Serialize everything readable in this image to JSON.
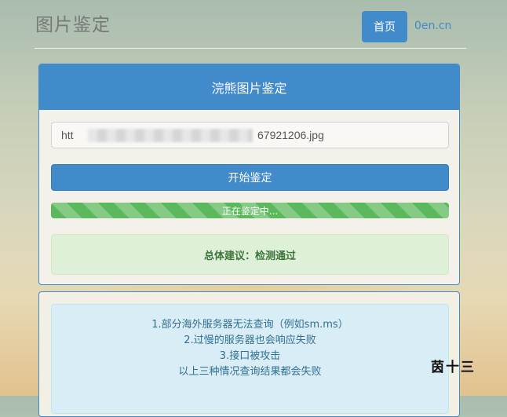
{
  "header": {
    "brand": "图片鉴定",
    "nav": {
      "home_label": "首页",
      "link_label": "0en.cn"
    }
  },
  "panel": {
    "title": "浣熊图片鉴定",
    "url_value_prefix": "htt",
    "url_value_suffix": "67921206.jpg",
    "start_button": "开始鉴定",
    "progress": {
      "label": "正在鉴定中...",
      "percent": 100
    },
    "result": "总体建议：检测通过"
  },
  "notice": {
    "lines": [
      "1.部分海外服务器无法查询（例如sm.ms）",
      "2.过慢的服务器也会响应失败",
      "3.接口被攻击",
      "以上三种情况查询结果都会失败"
    ]
  },
  "watermark": "茵十三",
  "colors": {
    "primary": "#428bca",
    "success": "#5cb85c",
    "info_text": "#31708f"
  }
}
